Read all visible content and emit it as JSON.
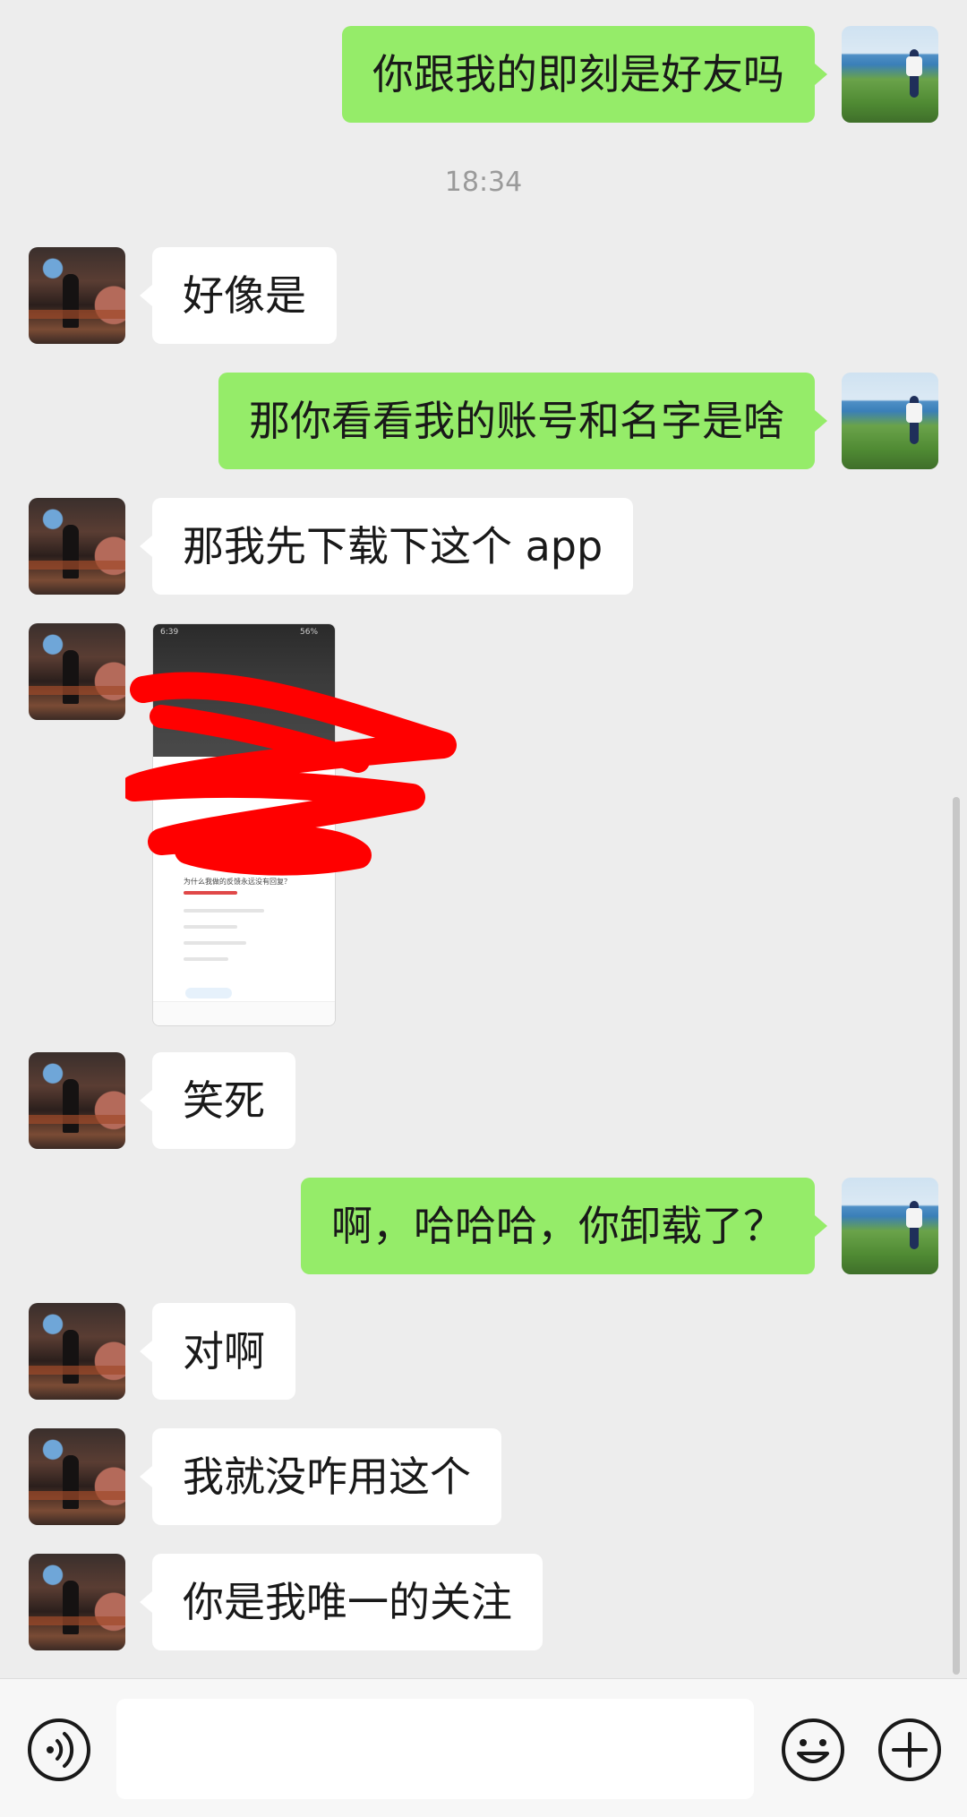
{
  "messages": [
    {
      "side": "me",
      "text": "你跟我的即刻是好友吗"
    },
    {
      "side": "system",
      "text": "18:34"
    },
    {
      "side": "other",
      "text": "好像是"
    },
    {
      "side": "me",
      "text": "那你看看我的账号和名字是啥"
    },
    {
      "side": "other",
      "text": "那我先下载下这个 app"
    },
    {
      "side": "other",
      "type": "image",
      "status_time": "6:39",
      "battery": "56%",
      "caption": "为什么我做的反馈永远没有回复？"
    },
    {
      "side": "other",
      "text": "笑死"
    },
    {
      "side": "me",
      "text": "啊，哈哈哈，你卸载了？"
    },
    {
      "side": "other",
      "text": "对啊"
    },
    {
      "side": "other",
      "text": "我就没咋用这个"
    },
    {
      "side": "other",
      "text": "你是我唯一的关注"
    }
  ],
  "input": {
    "value": "",
    "placeholder": ""
  },
  "icons": {
    "voice": "voice-icon",
    "emoji": "emoji-icon",
    "plus": "plus-icon"
  },
  "colors": {
    "me_bubble": "#95ec69",
    "other_bubble": "#ffffff",
    "background": "#ededed",
    "scribble": "#ff0000"
  }
}
